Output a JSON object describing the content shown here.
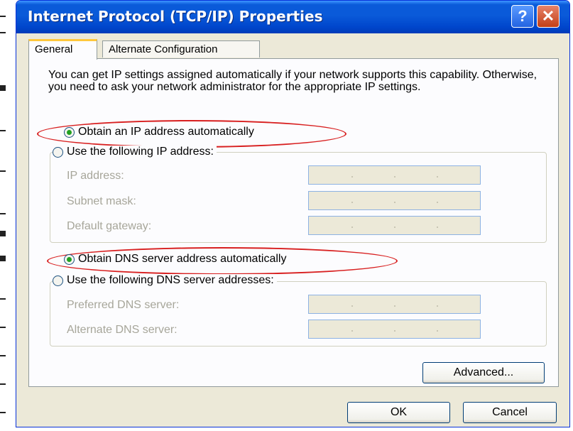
{
  "window": {
    "title": "Internet Protocol (TCP/IP) Properties"
  },
  "titlebar_buttons": {
    "help": "?",
    "close": "✕"
  },
  "tabs": [
    {
      "label": "General",
      "active": true
    },
    {
      "label": "Alternate Configuration",
      "active": false
    }
  ],
  "intro_text": "You can get IP settings assigned automatically if your network supports this capability. Otherwise, you need to ask your network administrator for the appropriate IP settings.",
  "ip": {
    "auto_label": "Obtain an IP address automatically",
    "auto_selected": true,
    "manual_label": "Use the following IP address:",
    "fields": [
      {
        "label": "IP address:",
        "value": ""
      },
      {
        "label": "Subnet mask:",
        "value": ""
      },
      {
        "label": "Default gateway:",
        "value": ""
      }
    ]
  },
  "dns": {
    "auto_label": "Obtain DNS server address automatically",
    "auto_selected": true,
    "manual_label": "Use the following DNS server addresses:",
    "fields": [
      {
        "label": "Preferred DNS server:",
        "value": ""
      },
      {
        "label": "Alternate DNS server:",
        "value": ""
      }
    ]
  },
  "buttons": {
    "advanced": "Advanced...",
    "ok": "OK",
    "cancel": "Cancel"
  },
  "colors": {
    "highlight_ellipse": "#d81f1f",
    "titlebar": "#0a5ad9",
    "selected_radio": "#21a121"
  }
}
